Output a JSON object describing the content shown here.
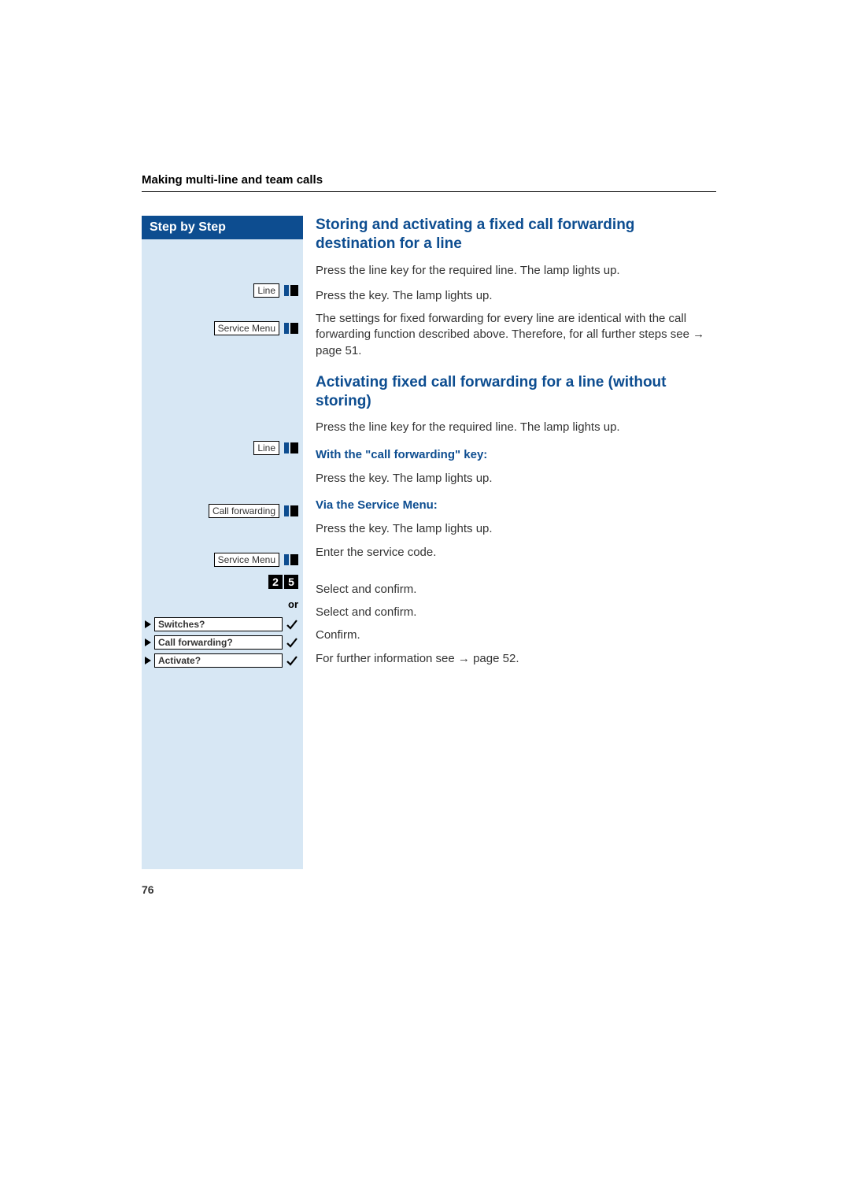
{
  "header": {
    "section": "Making multi-line and team calls"
  },
  "sidebar": {
    "title": "Step by Step",
    "keys": {
      "line": "Line",
      "service_menu": "Service Menu",
      "call_forwarding": "Call forwarding"
    },
    "code": {
      "d1": "2",
      "d2": "5"
    },
    "or": "or",
    "menu": {
      "switches": "Switches?",
      "call_forwarding": "Call forwarding?",
      "activate": "Activate?"
    }
  },
  "main": {
    "h1": "Storing and activating a fixed call forwarding destination for a line",
    "p1": "Press the line key for the required line. The lamp lights up.",
    "p2": "Press the key. The lamp lights up.",
    "p3": "The settings for fixed forwarding for every line are identical with the call forwarding function described above. Therefore, for all further steps see ",
    "p3_link": "page 51.",
    "h2": "Activating fixed call forwarding for a line (without storing)",
    "p4": "Press the line key for the required line. The lamp lights up.",
    "h3": "With the \"call forwarding\" key:",
    "p5": "Press the key. The lamp lights up.",
    "h4": "Via the Service Menu:",
    "p6": "Press the key. The lamp lights up.",
    "p7": "Enter the service code.",
    "p8": "Select and confirm.",
    "p9": "Select and confirm.",
    "p10": "Confirm.",
    "p11a": "For further information see ",
    "p11b": "page 52."
  },
  "page_number": "76"
}
